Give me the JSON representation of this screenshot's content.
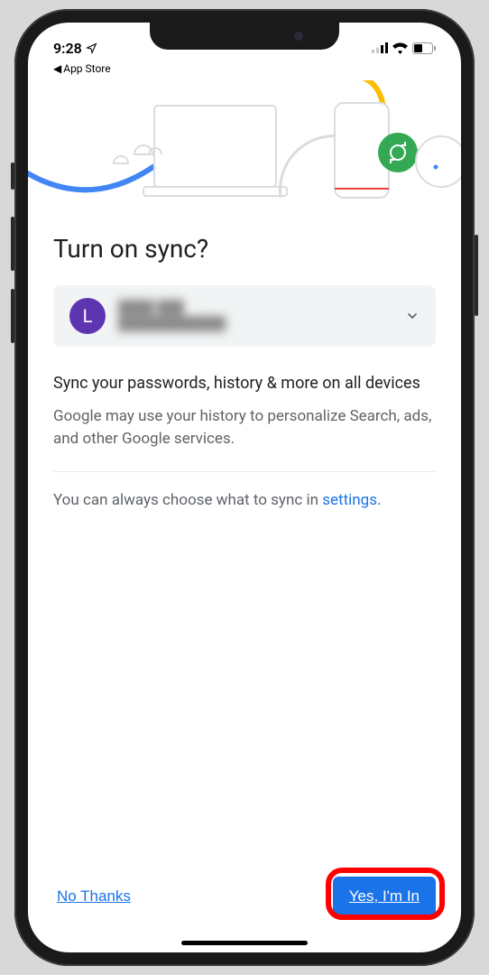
{
  "status_bar": {
    "time": "9:28",
    "back_app_label": "App Store"
  },
  "page": {
    "title": "Turn on sync?",
    "account": {
      "avatar_initial": "L",
      "name_blurred": "████ ███",
      "email_blurred": "████████████"
    },
    "subtitle": "Sync your passwords, history & more on all devices",
    "description": "Google may use your history to personalize Search, ads, and other Google services.",
    "settings_prefix": "You can always choose what to sync in ",
    "settings_link": "settings",
    "settings_suffix": "."
  },
  "buttons": {
    "decline": "No Thanks",
    "accept": "Yes, I'm In"
  }
}
